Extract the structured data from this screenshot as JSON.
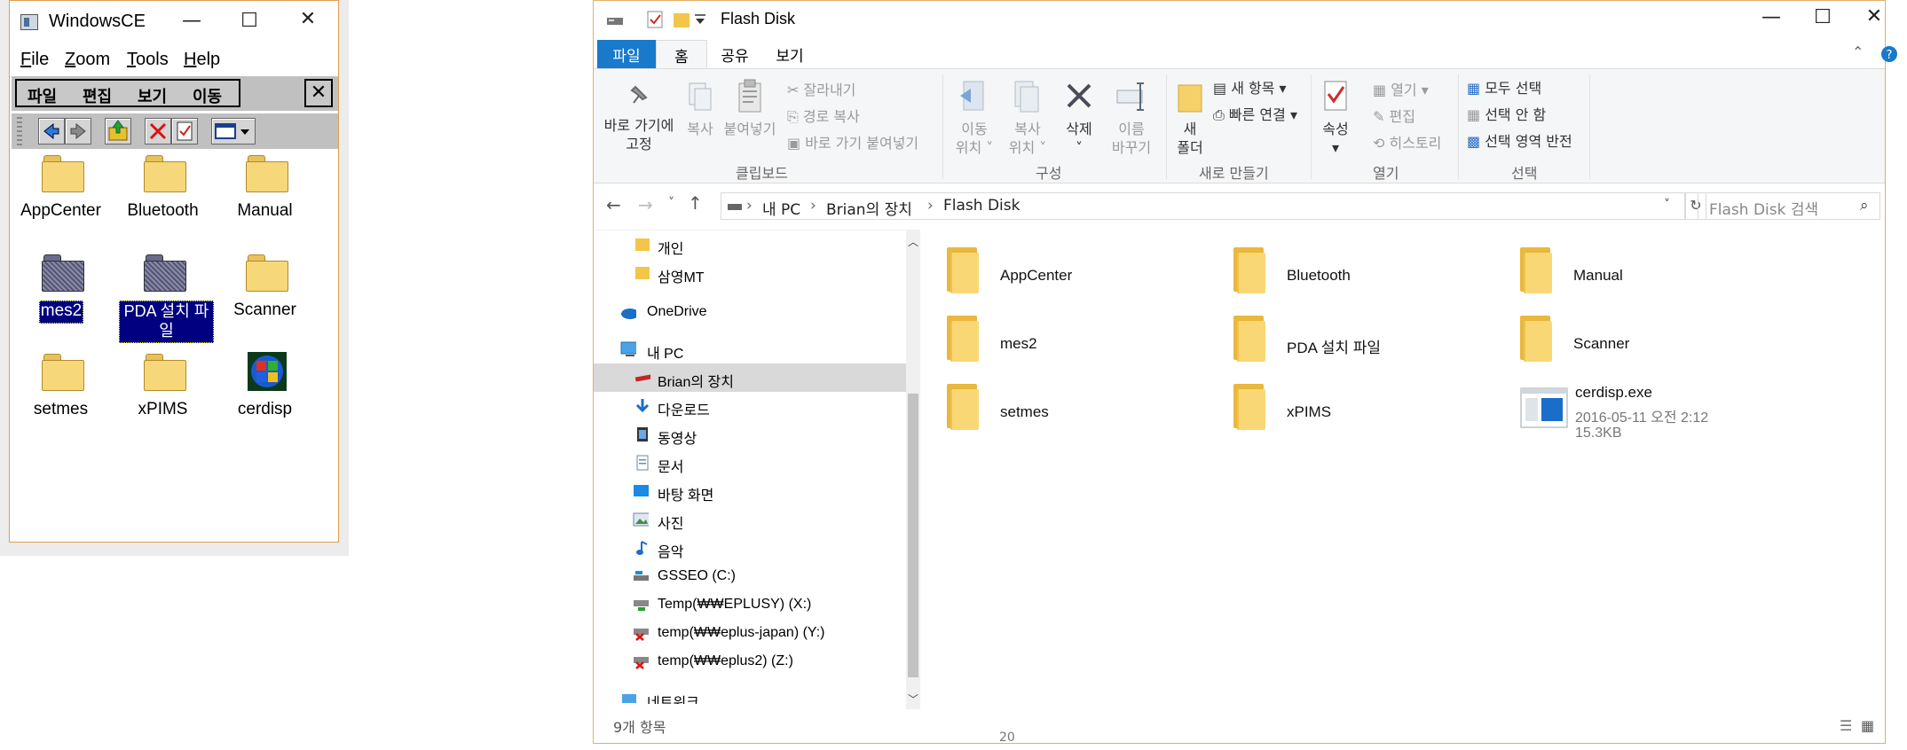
{
  "ce": {
    "title": "WindowsCE",
    "menu": [
      "File",
      "Zoom",
      "Tools",
      "Help"
    ],
    "menu_keys": [
      "F",
      "Z",
      "T",
      "H"
    ],
    "menu_rest": [
      "ile",
      "oom",
      "ools",
      "elp"
    ],
    "kor_menu": [
      "파일",
      "편집",
      "보기",
      "이동"
    ],
    "close_label": "✕",
    "icons": [
      {
        "label": "AppCenter",
        "type": "folder"
      },
      {
        "label": "Bluetooth",
        "type": "folder"
      },
      {
        "label": "Manual",
        "type": "folder"
      },
      {
        "label": "mes2",
        "type": "folder-hidden",
        "selected": true
      },
      {
        "label": "PDA 설치 파일",
        "type": "folder-hidden",
        "selected": true
      },
      {
        "label": "Scanner",
        "type": "folder"
      },
      {
        "label": "setmes",
        "type": "folder"
      },
      {
        "label": "xPIMS",
        "type": "folder"
      },
      {
        "label": "cerdisp",
        "type": "exe"
      }
    ]
  },
  "explorer": {
    "title": "Flash Disk",
    "tabs": [
      "파일",
      "홈",
      "공유",
      "보기"
    ],
    "ribbon": {
      "clipboard": {
        "label": "클립보드",
        "pin": "바로 가기에\n고정",
        "pin_l1": "바로 가기에",
        "pin_l2": "고정",
        "copy": "복사",
        "paste": "붙여넣기",
        "cut": "잘라내기",
        "copy_path": "경로 복사",
        "paste_shortcut": "바로 가기 붙여넣기"
      },
      "organize": {
        "label": "구성",
        "move_l1": "이동",
        "move_l2": "위치",
        "copyto_l1": "복사",
        "copyto_l2": "위치",
        "delete": "삭제",
        "rename_l1": "이름",
        "rename_l2": "바꾸기"
      },
      "new": {
        "label": "새로 만들기",
        "folder_l1": "새",
        "folder_l2": "폴더",
        "new_item": "새 항목",
        "easy_access": "빠른 연결"
      },
      "open": {
        "label": "열기",
        "properties": "속성",
        "open": "열기",
        "edit": "편집",
        "history": "히스토리"
      },
      "select": {
        "label": "선택",
        "all": "모두 선택",
        "none": "선택 안 함",
        "invert": "선택 영역 반전"
      }
    },
    "address": {
      "parts": [
        "내 PC",
        "Brian의 장치",
        "Flash Disk"
      ],
      "search_placeholder": "Flash Disk 검색"
    },
    "nav": [
      {
        "label": "개인",
        "icon": "folder-icon"
      },
      {
        "label": "삼영MT",
        "icon": "folder-icon"
      },
      {
        "label": "OneDrive",
        "icon": "cloud-icon"
      },
      {
        "label": "내 PC",
        "icon": "computer-icon"
      },
      {
        "label": "Brian의 장치",
        "icon": "device-icon",
        "selected": true
      },
      {
        "label": "다운로드",
        "icon": "download-icon"
      },
      {
        "label": "동영상",
        "icon": "video-icon"
      },
      {
        "label": "문서",
        "icon": "document-icon"
      },
      {
        "label": "바탕 화면",
        "icon": "desktop-icon"
      },
      {
        "label": "사진",
        "icon": "picture-icon"
      },
      {
        "label": "음악",
        "icon": "music-icon"
      },
      {
        "label": "GSSEO (C:)",
        "icon": "drive-icon"
      },
      {
        "label": "Temp(₩₩EPLUSY) (X:)",
        "icon": "network-drive-icon"
      },
      {
        "label": "temp(₩₩eplus-japan) (Y:)",
        "icon": "network-drive-error-icon"
      },
      {
        "label": "temp(₩₩eplus2) (Z:)",
        "icon": "network-drive-error-icon"
      },
      {
        "label": "네트워크",
        "icon": "network-icon"
      }
    ],
    "items": [
      {
        "name": "AppCenter"
      },
      {
        "name": "Bluetooth"
      },
      {
        "name": "Manual"
      },
      {
        "name": "mes2"
      },
      {
        "name": "PDA 설치 파일"
      },
      {
        "name": "Scanner"
      },
      {
        "name": "setmes"
      },
      {
        "name": "xPIMS"
      },
      {
        "name": "cerdisp.exe",
        "date": "2016-05-11 오전 2:12",
        "size": "15.3KB"
      }
    ],
    "status": "9개 항목"
  },
  "background": {
    "frag_20": "20"
  }
}
